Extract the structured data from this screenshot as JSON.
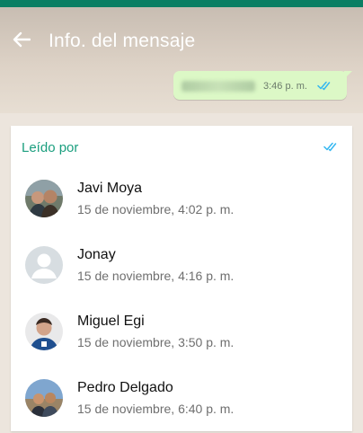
{
  "header": {
    "title": "Info. del mensaje",
    "back_icon": "arrow-left-icon"
  },
  "message": {
    "time": "3:46 p. m.",
    "status_icon": "double-check-icon",
    "status_color": "#34b7f1"
  },
  "read_by": {
    "title": "Leído por",
    "title_color": "#1a9e7e",
    "status_icon": "double-check-icon",
    "entries": [
      {
        "name": "Javi Moya",
        "time": "15 de noviembre, 4:02 p. m."
      },
      {
        "name": "Jonay",
        "time": "15 de noviembre, 4:16 p. m."
      },
      {
        "name": "Miguel Egi",
        "time": "15 de noviembre, 3:50 p. m."
      },
      {
        "name": "Pedro Delgado",
        "time": "15 de noviembre, 6:40 p. m."
      }
    ]
  },
  "colors": {
    "primary_dark": "#0a7e63",
    "bubble": "#dcf8c6",
    "accent": "#1a9e7e"
  }
}
